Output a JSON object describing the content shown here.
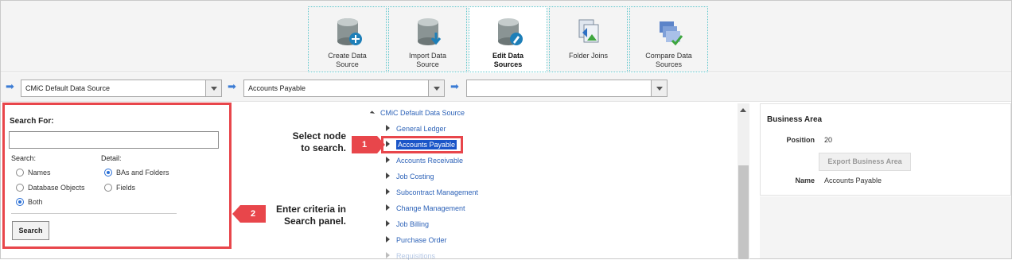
{
  "toolbar": {
    "tools": [
      {
        "label_1": "Create Data",
        "label_2": "Source",
        "icon": "database-add-icon"
      },
      {
        "label_1": "Import Data",
        "label_2": "Source",
        "icon": "database-import-icon"
      },
      {
        "label_1": "Edit Data",
        "label_2": "Sources",
        "icon": "database-edit-icon",
        "active": true
      },
      {
        "label_1": "Folder Joins",
        "label_2": "",
        "icon": "folder-joins-icon"
      },
      {
        "label_1": "Compare Data",
        "label_2": "Sources",
        "icon": "compare-icon"
      }
    ]
  },
  "selectors": {
    "data_source": "CMiC Default Data Source",
    "business_area": "Accounts Payable",
    "folder": ""
  },
  "search_panel": {
    "title": "Search For:",
    "input_value": "",
    "search_label": "Search:",
    "detail_label": "Detail:",
    "search_options": [
      "Names",
      "Database Objects",
      "Both"
    ],
    "search_selected": "Both",
    "detail_options": [
      "BAs and Folders",
      "Fields"
    ],
    "detail_selected": "BAs and Folders",
    "button": "Search"
  },
  "tree": {
    "root": "CMiC Default Data Source",
    "nodes": [
      "General Ledger",
      "Accounts Payable",
      "Accounts Receivable",
      "Job Costing",
      "Subcontract Management",
      "Change Management",
      "Job Billing",
      "Purchase Order",
      "Requisitions"
    ],
    "selected": "Accounts Payable"
  },
  "annotations": {
    "callout1_number": "1",
    "callout1_line1": "Select node",
    "callout1_line2": "to search.",
    "callout2_number": "2",
    "callout2_line1": "Enter criteria in",
    "callout2_line2": "Search panel."
  },
  "business_area_panel": {
    "title": "Business Area",
    "position_label": "Position",
    "position_value": "20",
    "export_button": "Export Business Area",
    "name_label": "Name",
    "name_value": "Accounts Payable"
  },
  "colors": {
    "callout": "#e8464b",
    "link": "#2e63b8",
    "selection": "#1a55c8"
  }
}
